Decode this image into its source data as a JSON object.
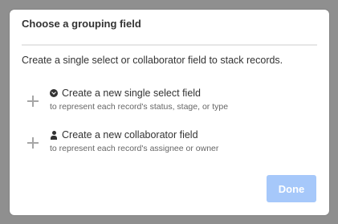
{
  "dialog": {
    "title": "Choose a grouping field",
    "description": "Create a single select or collaborator field to stack records.",
    "options": [
      {
        "icon": "chevron-circle-icon",
        "title": "Create a new single select field",
        "subtitle": "to represent each record's status, stage, or type"
      },
      {
        "icon": "person-icon",
        "title": "Create a new collaborator field",
        "subtitle": "to represent each record's assignee or owner"
      }
    ],
    "done_label": "Done"
  },
  "colors": {
    "backdrop": "#8f8f8f",
    "dialog_bg": "#ffffff",
    "done_button_bg": "#a6c8fa",
    "plus_icon": "#a6a6a6"
  }
}
